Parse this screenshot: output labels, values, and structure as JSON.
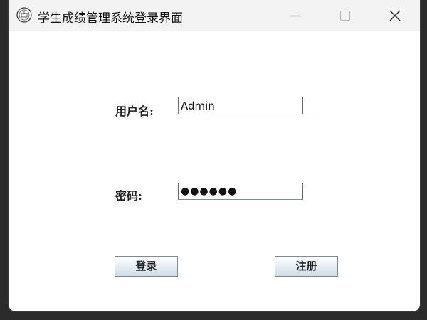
{
  "window": {
    "title": "学生成绩管理系统登录界面",
    "app_icon": "app-logo-icon",
    "controls": {
      "minimize_icon": "minimize-icon",
      "maximize_icon": "maximize-icon",
      "close_icon": "close-icon"
    }
  },
  "form": {
    "username_label": "用户名:",
    "username_value": "Admin",
    "password_label": "密码:",
    "password_value": "●●●●●●"
  },
  "buttons": {
    "login_label": "登录",
    "register_label": "注册"
  },
  "colors": {
    "titlebar_bg": "#f3f3f3",
    "window_bg": "#ffffff",
    "button_border": "#7a8a99"
  }
}
